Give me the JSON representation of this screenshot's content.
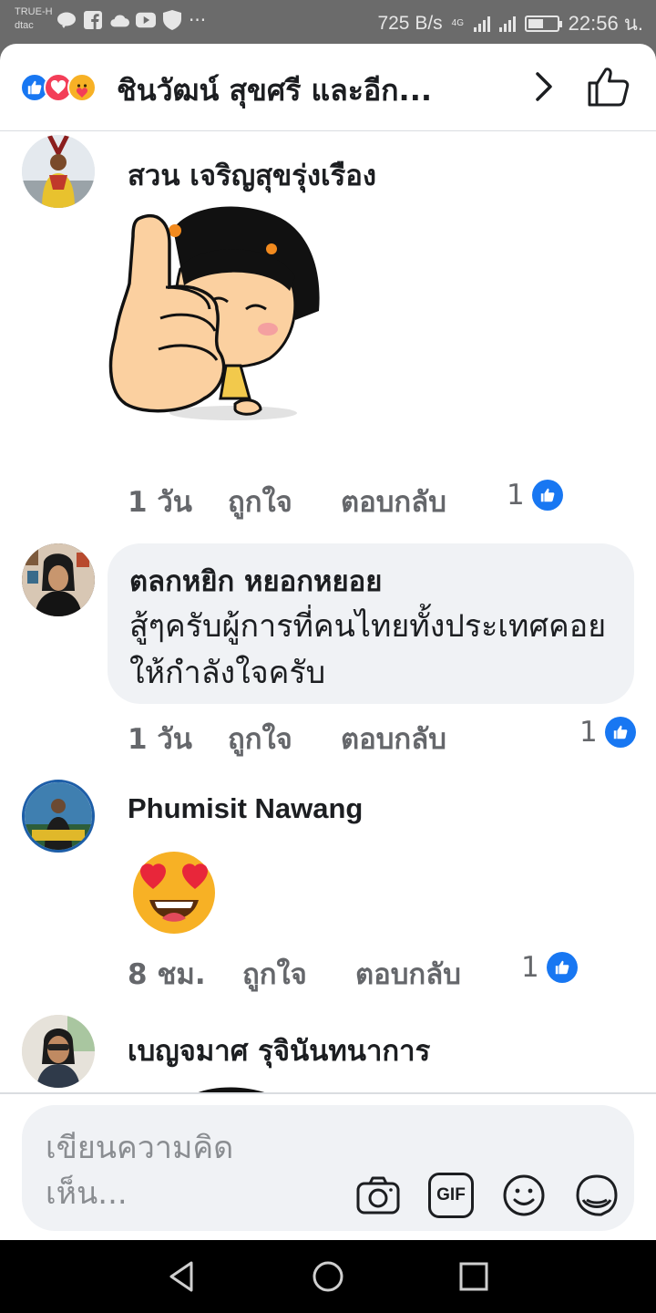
{
  "status_bar": {
    "carrier_top": "TRUE-H",
    "carrier_bottom": "dtac",
    "net_speed": "725 B/s",
    "network_type": "4G",
    "time": "22:56 น.",
    "battery_level": 0.55,
    "icons": [
      "line-icon",
      "facebook-icon",
      "cloud-icon",
      "youtube-icon",
      "shield-icon",
      "more-dots-icon",
      "signal-icon",
      "battery-icon"
    ]
  },
  "header": {
    "reaction_icons": [
      "like-reaction-icon",
      "love-reaction-icon",
      "care-reaction-icon"
    ],
    "title": "ชินวัฒน์ สุขศรี และอีก...",
    "colors": {
      "like": "#1877f2",
      "love": "#f33e58",
      "care": "#f7b125"
    }
  },
  "comments": [
    {
      "author": "สวน เจริญสุขรุ่งเรือง",
      "content_type": "sticker",
      "sticker": "thumbs-up-girl-sticker",
      "time": "1 วัน",
      "like_label": "ถูกใจ",
      "reply_label": "ตอบกลับ",
      "like_count": "1"
    },
    {
      "author": "ตลกหยิก หยอกหยอย",
      "content_type": "text",
      "text": "สู้ๆครับผู้การที่คนไทยทั้งประเทศคอยให้กำลังใจครับ",
      "time": "1 วัน",
      "like_label": "ถูกใจ",
      "reply_label": "ตอบกลับ",
      "like_count": "1"
    },
    {
      "author": "Phumisit Nawang",
      "content_type": "emoji",
      "emoji": "heart-eyes-emoji",
      "time": "8 ชม.",
      "like_label": "ถูกใจ",
      "reply_label": "ตอบกลับ",
      "like_count": "1"
    },
    {
      "author": "เบญจมาศ รุจินันทนาการ",
      "content_type": "sticker",
      "sticker": "thumbs-up-girl-sticker"
    }
  ],
  "composer": {
    "placeholder": "เขียนความคิดเห็น...",
    "actions": [
      "camera-icon",
      "gif-icon",
      "emoji-icon",
      "sticker-icon"
    ],
    "gif_label": "GIF"
  },
  "nav_bar": {
    "buttons": [
      "back-button",
      "home-button",
      "recents-button"
    ]
  }
}
